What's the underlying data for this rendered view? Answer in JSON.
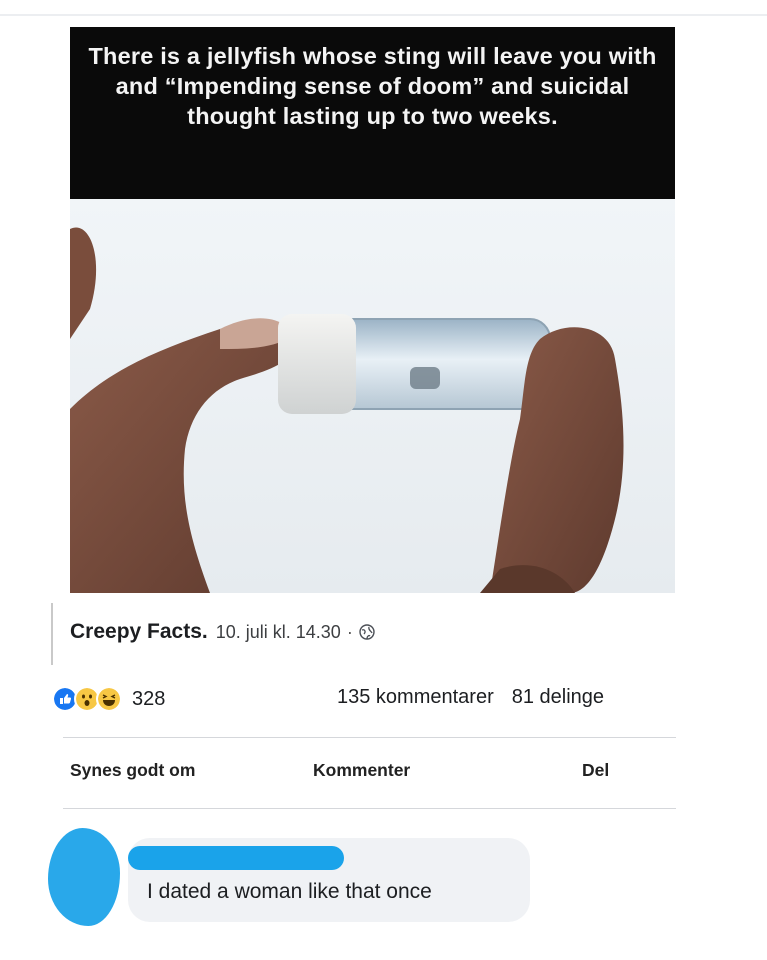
{
  "post": {
    "caption": "There is a jellyfish whose sting will leave you with and “Impending sense of doom” and suicidal thought lasting up to two weeks.",
    "page_name": "Creepy Facts.",
    "timestamp": "10. juli kl. 14.30",
    "separator": "·",
    "audience_icon": "globe-icon"
  },
  "engagement": {
    "reaction_icons": [
      "like-icon",
      "wow-icon",
      "haha-icon"
    ],
    "reaction_count": "328",
    "comments": "135 kommentarer",
    "shares": "81 delinge"
  },
  "actions": {
    "like": "Synes godt om",
    "comment": "Kommenter",
    "share": "Del"
  },
  "comment": {
    "text": "I dated a woman like that once"
  },
  "colors": {
    "like_blue": "#1877f2",
    "redaction_blue": "#1aa3ea",
    "bubble_bg": "#f0f2f5"
  }
}
